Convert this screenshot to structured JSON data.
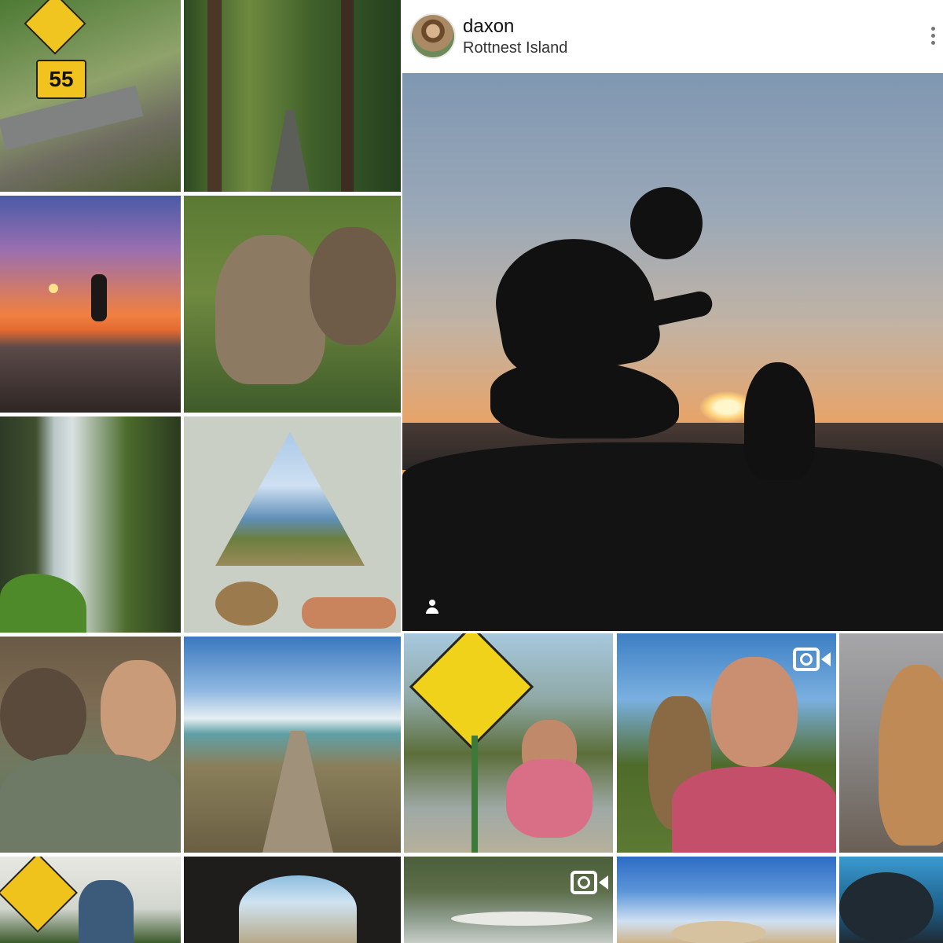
{
  "post": {
    "username": "daxon",
    "location": "Rottnest Island"
  },
  "grid_left": [
    {
      "name": "wombat-sign-road",
      "colors": [
        "#3f6b2f",
        "#8fa36b",
        "#6c6a5f"
      ]
    },
    {
      "name": "forest-path",
      "colors": [
        "#2d4a22",
        "#6e8a3f",
        "#5b4030"
      ]
    },
    {
      "name": "sunset-mountain-pose",
      "colors": [
        "#6b5aa8",
        "#f0743a",
        "#3a2e2c"
      ]
    },
    {
      "name": "quokka-grass",
      "colors": [
        "#5b7a33",
        "#8c7a62",
        "#3f5b2a"
      ]
    },
    {
      "name": "waterfall-ferns",
      "colors": [
        "#2d3a25",
        "#b6c7c7",
        "#4c6b2c"
      ]
    },
    {
      "name": "tent-view-lake",
      "colors": [
        "#c9cfc4",
        "#5f8fb7",
        "#6b7f3e"
      ]
    },
    {
      "name": "wombat-selfie",
      "colors": [
        "#6a5a45",
        "#c99b78",
        "#5b6a55"
      ]
    },
    {
      "name": "boardwalk-beach",
      "colors": [
        "#4f86c4",
        "#bcd0cf",
        "#6a5f43"
      ]
    },
    {
      "name": "devil-sign",
      "colors": [
        "#f0c21c",
        "#d9d9cf",
        "#3c5a2c"
      ]
    },
    {
      "name": "sea-cave",
      "colors": [
        "#1f1d1b",
        "#8dbde0",
        "#b6a98a"
      ]
    }
  ],
  "grid_bottom": [
    {
      "name": "kangaroo-sign-selfie",
      "colors": [
        "#f0d21a",
        "#9fa9a6",
        "#5b6e3a"
      ]
    },
    {
      "name": "giraffe-selfie",
      "colors": [
        "#3d7fc4",
        "#c44f6b",
        "#4f6b2a"
      ]
    },
    {
      "name": "quokka-closeup",
      "colors": [
        "#a6a6a8",
        "#c08a56",
        "#5b4a3a"
      ]
    },
    {
      "name": "kayaks",
      "colors": [
        "#5d6e4a",
        "#c7ccc7",
        "#3a4f3a"
      ]
    },
    {
      "name": "beach-hat",
      "colors": [
        "#2d6cc6",
        "#cfe0f2",
        "#cfb48a"
      ]
    },
    {
      "name": "sea-lion",
      "colors": [
        "#1e5f8a",
        "#3a9ad0",
        "#1f2a33"
      ]
    }
  ],
  "icons": {
    "more": "more-vert-icon",
    "tag": "person-tag-icon",
    "video": "video-camera-icon"
  }
}
